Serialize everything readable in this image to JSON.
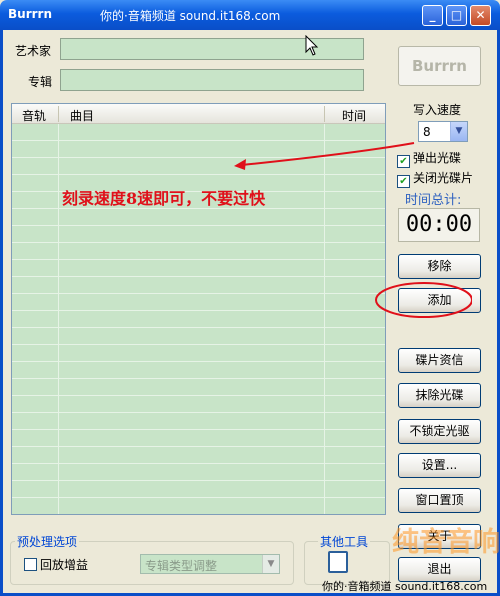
{
  "window": {
    "title": "Burrrn",
    "watermark_title": "你的·音箱频道 sound.it168.com"
  },
  "form": {
    "artist_label": "艺术家",
    "album_label": "专辑",
    "artist_value": "",
    "album_value": ""
  },
  "burn_button": "Burrrn",
  "tracklist": {
    "columns": [
      "音轨",
      "曲目",
      "时间"
    ]
  },
  "annotation": "刻录速度8速即可，不要过快",
  "speed": {
    "label": "写入速度",
    "value": "8"
  },
  "options": {
    "eject_label": "弹出光碟",
    "eject_checked": true,
    "close_label": "关闭光碟片",
    "close_checked": true
  },
  "total_time": {
    "label": "时间总计:",
    "value": "00:00"
  },
  "buttons": {
    "remove": "移除",
    "add": "添加",
    "cd_info": "碟片资信",
    "erase": "抹除光碟",
    "unlock": "不锁定光驱",
    "settings": "设置...",
    "ontop": "窗口置顶",
    "about": "关于",
    "exit": "退出"
  },
  "preprocess": {
    "title": "预处理选项",
    "gain_label": "回放增益",
    "gain_checked": false,
    "combo_value": "专辑类型调整"
  },
  "other_tools": {
    "title": "其他工具"
  },
  "watermark": {
    "brand": "纯音音响",
    "footer": "你的·音箱频道 sound.it168.com"
  },
  "colors": {
    "titlebar": "#0a4ec8",
    "list_bg": "#c8e4c8",
    "annotation": "#e0101a"
  }
}
